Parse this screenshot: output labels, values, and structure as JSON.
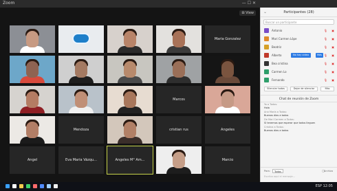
{
  "titlebar": {
    "title": "Zoom",
    "controls": "— ☐ ✕"
  },
  "gallery": {
    "view_label": "⊞ View",
    "tiles": [
      {
        "type": "video",
        "caption": "",
        "skin": "#c79a82",
        "bg": "#8c8f95",
        "shirt": "#ffffff"
      },
      {
        "type": "logo",
        "caption": "",
        "bg": "#e9ecef"
      },
      {
        "type": "video",
        "caption": "",
        "skin": "#b88469",
        "bg": "#d7d1cc",
        "shirt": "#2b2b2b"
      },
      {
        "type": "video",
        "caption": "",
        "skin": "#a87258",
        "bg": "#e3e1de",
        "shirt": "#3b3b3b"
      },
      {
        "type": "name",
        "name": "Maria Gonzalez"
      },
      {
        "type": "video",
        "caption": "",
        "skin": "#8e6352",
        "bg": "#6da7c9",
        "shirt": "#d84a3c"
      },
      {
        "type": "video",
        "caption": "",
        "skin": "#a47a62",
        "bg": "#cfcfcf",
        "shirt": "#1e1e1e"
      },
      {
        "type": "video",
        "caption": "",
        "skin": "#b88a6c",
        "bg": "#c8c6c0",
        "shirt": "#4a4a4a"
      },
      {
        "type": "video",
        "caption": "",
        "skin": "#9a6f58",
        "bg": "#9fa2a4",
        "shirt": "#2e2e2e"
      },
      {
        "type": "video",
        "caption": "",
        "skin": "#7a543f",
        "bg": "#151515",
        "shirt": "#6a4a3a"
      },
      {
        "type": "video",
        "caption": "",
        "skin": "#b47c63",
        "bg": "#d6d3cf",
        "shirt": "#8f1f24"
      },
      {
        "type": "video",
        "caption": "",
        "skin": "#c08f76",
        "bg": "#b9c2ca",
        "shirt": "#f0f0f0"
      },
      {
        "type": "video",
        "caption": "",
        "skin": "#a8775c",
        "bg": "#e7dcd1",
        "shirt": "#222222"
      },
      {
        "type": "name",
        "name": "Marcos"
      },
      {
        "type": "video",
        "caption": "",
        "skin": "#c69a86",
        "bg": "#d9a798",
        "shirt": "#ffffff"
      },
      {
        "type": "video",
        "caption": "",
        "skin": "#b27e66",
        "bg": "#ece9e5",
        "shirt": "#1b1b1b"
      },
      {
        "type": "name",
        "name": "Mendoza"
      },
      {
        "type": "video",
        "caption": "",
        "skin": "#b18066",
        "bg": "#d3c7bb",
        "shirt": "#3a2e2a"
      },
      {
        "type": "name",
        "name": "cristian rus"
      },
      {
        "type": "name",
        "name": "Angeles"
      },
      {
        "type": "name",
        "name": "Angel"
      },
      {
        "type": "name",
        "name": "Eva María Vázqu..."
      },
      {
        "type": "name",
        "name": "Angeles M° Am...",
        "active": true
      },
      {
        "type": "video",
        "caption": "",
        "skin": "#c59e88",
        "bg": "#eeeeee",
        "shirt": "#1d1d1d"
      },
      {
        "type": "name",
        "name": "Marcio"
      }
    ]
  },
  "participants": {
    "title": "Participantes (28)",
    "search_placeholder": "Buscar un participante",
    "rows": [
      {
        "name": "Antonio",
        "color": "#7a4cc7"
      },
      {
        "name": "Mari Carmen Lópe",
        "color": "#e08a2a"
      },
      {
        "name": "Beatriz",
        "color": "#d6a028"
      },
      {
        "name": "Alberto",
        "color": "#c0392b",
        "badge": "No hay video",
        "badge2": "Más"
      },
      {
        "name": "Bea cristina",
        "color": "#333333"
      },
      {
        "name": "Carmen Lo",
        "color": "#2e9e6a"
      },
      {
        "name": "Fernando",
        "color": "#2e9e6a"
      }
    ],
    "buttons": [
      "Silenciar todos",
      "Dejar de silenciar",
      "Más"
    ]
  },
  "chat": {
    "title": "Chat de reunión de Zoom",
    "messages": [
      {
        "from": "Yo a Todos:",
        "text": "Hola"
      },
      {
        "from": "Ana María a Todos:",
        "text": "Buenos días a todos"
      },
      {
        "from": "De Mari Carmen a Todos:",
        "text": "Si tenemos que esperar que todos lleguen"
      },
      {
        "from": "Cristina a Todos:",
        "text": "Buenos días a todos"
      }
    ],
    "to_label": "Para:",
    "to_value": "Todos",
    "file_label": "Archivo",
    "input_placeholder": "Escriba aquí el mensaje..."
  },
  "taskbar": {
    "icons": [
      "#3aa0ff",
      "#ffffff",
      "#f2c94c",
      "#3ccf6a",
      "#ff6b6b",
      "#4f8bff",
      "#9fd0ff",
      "#f1f1f1"
    ],
    "tray": "ESP  12:05"
  }
}
